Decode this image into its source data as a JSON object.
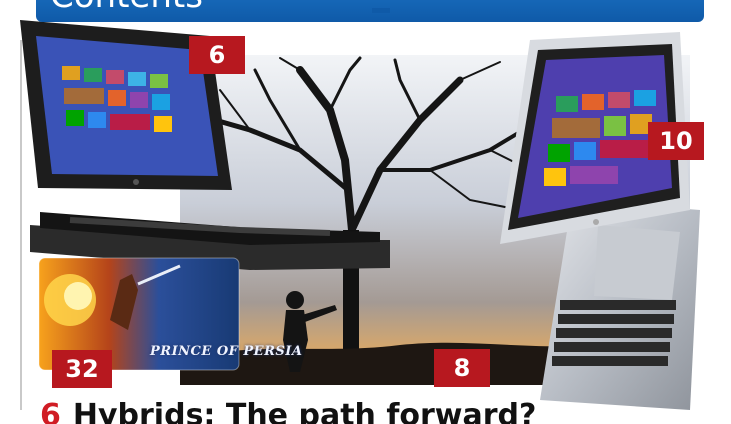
{
  "header": {
    "title": "Contents"
  },
  "badges": {
    "lenovo": "6",
    "acer": "10",
    "game": "32",
    "tree": "8"
  },
  "game_card": {
    "title": "PRINCE OF PERSIA"
  },
  "article": {
    "page": "6",
    "title": "Hybrids: The path forward?"
  },
  "colors": {
    "header_blue": "#1565b8",
    "badge_red": "#b7181f",
    "headline_red": "#d01c24"
  }
}
